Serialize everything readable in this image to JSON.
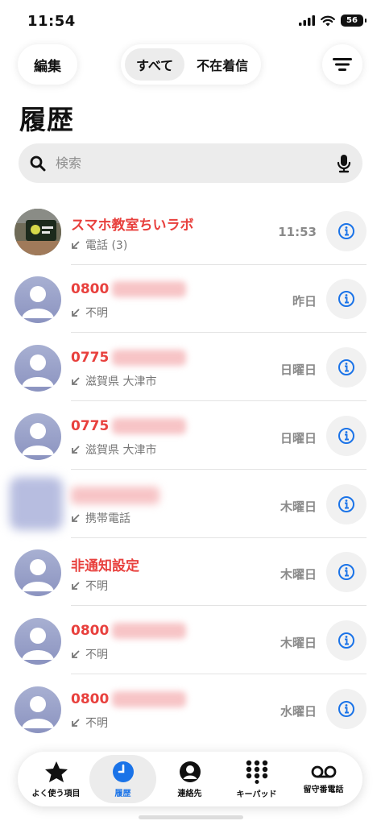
{
  "status": {
    "time": "11:54",
    "battery": "56"
  },
  "toolbar": {
    "edit_label": "編集",
    "segment_all": "すべて",
    "segment_missed": "不在着信"
  },
  "title": "履歴",
  "search": {
    "placeholder": "検索"
  },
  "calls": [
    {
      "name": "スマホ教室ちいラボ",
      "detail": "電話 (3)",
      "date": "11:53"
    },
    {
      "name": "0800",
      "detail": "不明",
      "date": "昨日"
    },
    {
      "name": "0775",
      "detail": "滋賀県 大津市",
      "date": "日曜日"
    },
    {
      "name": "0775",
      "detail": "滋賀県 大津市",
      "date": "日曜日"
    },
    {
      "name": "",
      "detail": "携帯電話",
      "date": "木曜日"
    },
    {
      "name": "非通知設定",
      "detail": "不明",
      "date": "木曜日"
    },
    {
      "name": "0800",
      "detail": "不明",
      "date": "木曜日"
    },
    {
      "name": "0800",
      "detail": "不明",
      "date": "水曜日"
    }
  ],
  "tabs": [
    {
      "label": "よく使う項目",
      "icon": "star-icon"
    },
    {
      "label": "履歴",
      "icon": "clock-icon"
    },
    {
      "label": "連絡先",
      "icon": "person-circle-icon"
    },
    {
      "label": "キーパッド",
      "icon": "keypad-icon"
    },
    {
      "label": "留守番電話",
      "icon": "voicemail-icon"
    }
  ],
  "colors": {
    "missed": "#e8403d",
    "accent": "#1a73e8"
  }
}
